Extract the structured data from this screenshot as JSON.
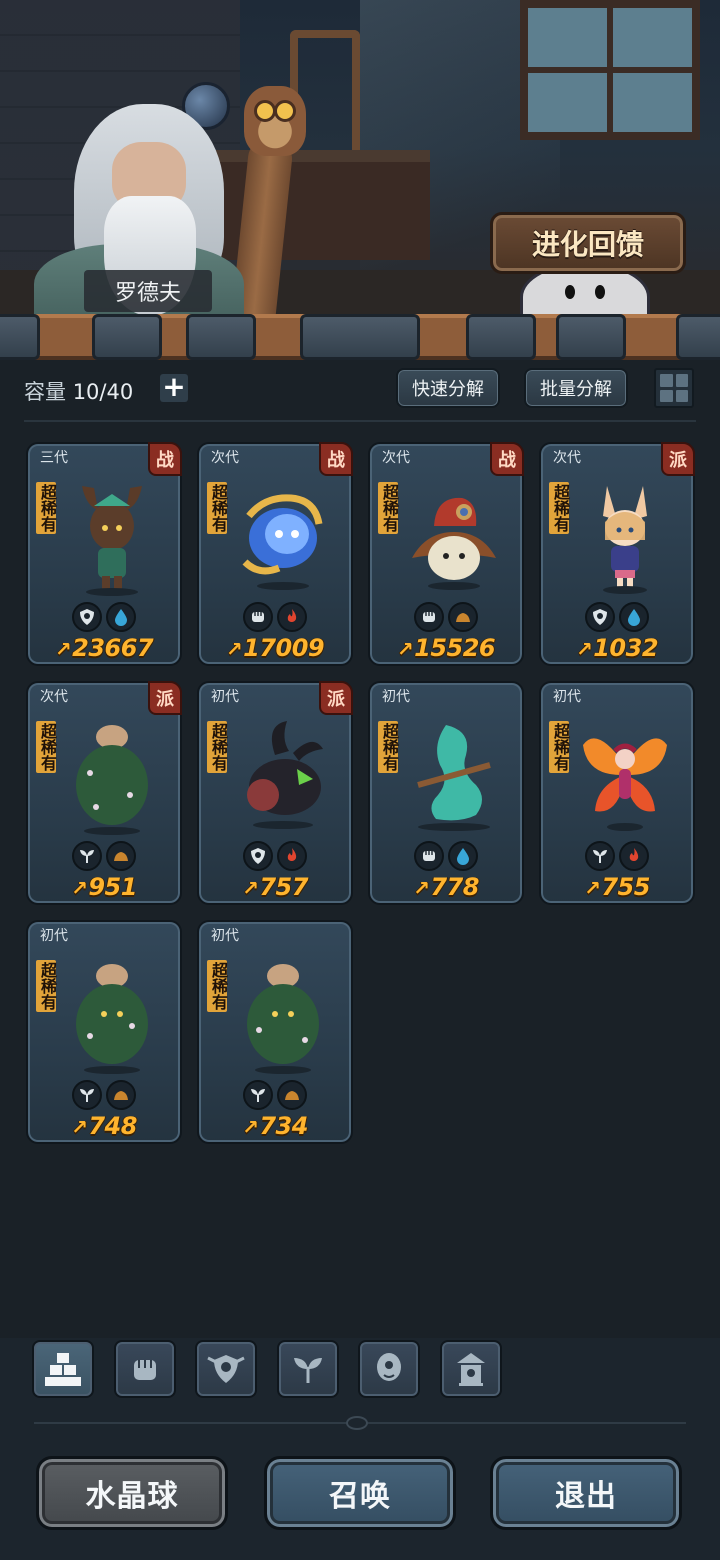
{
  "scene": {
    "npc_name": "罗德夫",
    "evolve_label": "进化回馈"
  },
  "toolbar": {
    "capacity_label": "容量",
    "capacity_value": "10/40",
    "add_label": "+",
    "quick_decompose": "快速分解",
    "batch_decompose": "批量分解"
  },
  "cards": [
    {
      "gen": "三代",
      "role": "战",
      "rarity": "超稀有",
      "power": "23667",
      "icons": [
        "shield-icon",
        "water-drop-icon"
      ],
      "creature": "tree-spirit"
    },
    {
      "gen": "次代",
      "role": "战",
      "rarity": "超稀有",
      "power": "17009",
      "icons": [
        "fist-icon",
        "fire-icon"
      ],
      "creature": "blue-flame-armor"
    },
    {
      "gen": "次代",
      "role": "战",
      "rarity": "超稀有",
      "power": "15526",
      "icons": [
        "fist-icon",
        "earth-icon"
      ],
      "creature": "hooded-blob"
    },
    {
      "gen": "次代",
      "role": "派",
      "rarity": "超稀有",
      "power": "1032",
      "icons": [
        "shield-icon",
        "water-drop-icon"
      ],
      "creature": "fox-girl"
    },
    {
      "gen": "次代",
      "role": "派",
      "rarity": "超稀有",
      "power": "951",
      "icons": [
        "sprout-icon",
        "earth-icon"
      ],
      "creature": "moss-golem"
    },
    {
      "gen": "初代",
      "role": "派",
      "rarity": "超稀有",
      "power": "757",
      "icons": [
        "shield-icon",
        "fire-icon"
      ],
      "creature": "dark-beast"
    },
    {
      "gen": "初代",
      "role": "",
      "rarity": "超稀有",
      "power": "778",
      "icons": [
        "fist-icon",
        "water-drop-icon"
      ],
      "creature": "water-spirit"
    },
    {
      "gen": "初代",
      "role": "",
      "rarity": "超稀有",
      "power": "755",
      "icons": [
        "sprout-icon",
        "fire-icon"
      ],
      "creature": "fire-butterfly"
    },
    {
      "gen": "初代",
      "role": "",
      "rarity": "超稀有",
      "power": "748",
      "icons": [
        "sprout-icon",
        "earth-icon"
      ],
      "creature": "moss-golem"
    },
    {
      "gen": "初代",
      "role": "",
      "rarity": "超稀有",
      "power": "734",
      "icons": [
        "sprout-icon",
        "earth-icon"
      ],
      "creature": "moss-golem"
    }
  ],
  "filters": [
    "all-blocks-icon",
    "fist-icon",
    "shield-icon",
    "sprout-icon",
    "alien-head-icon",
    "shrine-icon"
  ],
  "bottom": {
    "crystal_ball": "水晶球",
    "summon": "召唤",
    "exit": "退出"
  },
  "colors": {
    "power": "#ffb42e",
    "rarity_badge": "#e2a43a",
    "role_badge": "#8a2d22",
    "card_bg": "#2a3c4b"
  }
}
